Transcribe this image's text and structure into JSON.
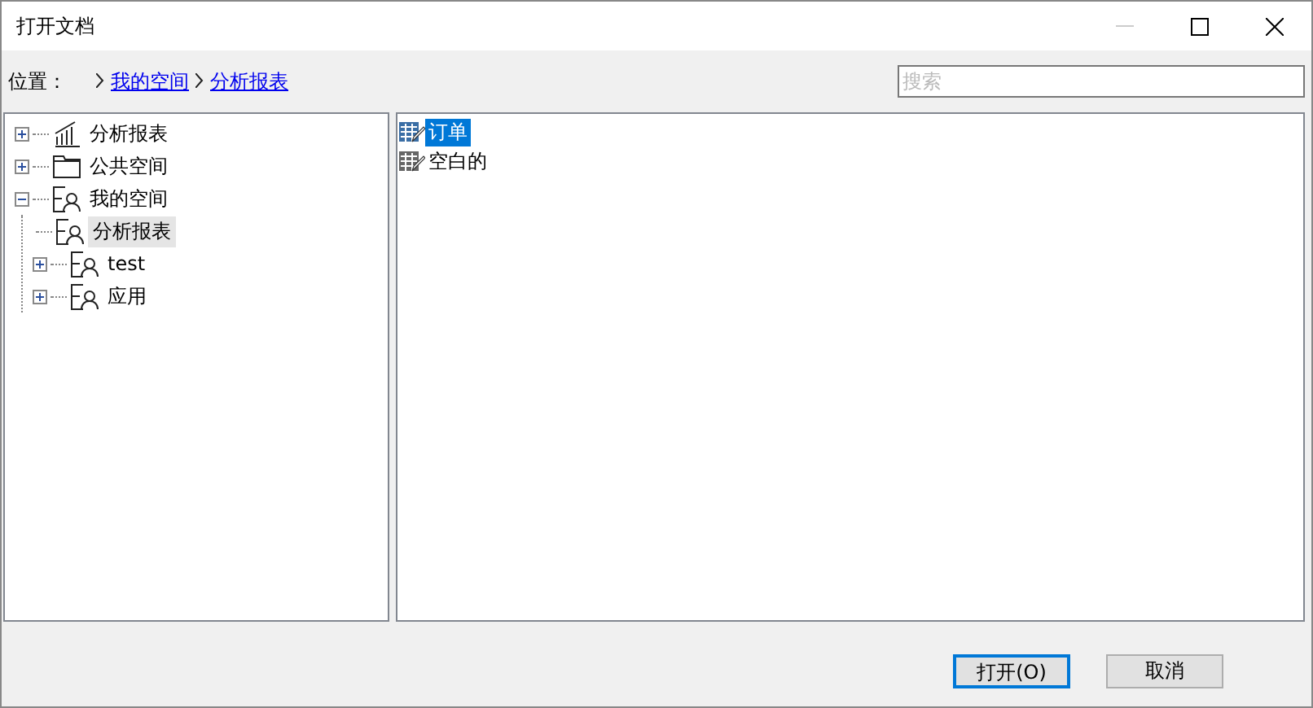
{
  "window": {
    "title": "打开文档",
    "minimize_disabled": true
  },
  "location": {
    "label": "位置：",
    "path": [
      {
        "label": "我的空间"
      },
      {
        "label": "分析报表"
      }
    ]
  },
  "search": {
    "placeholder": "搜索"
  },
  "tree": [
    {
      "label": "分析报表",
      "kind": "chart",
      "expanded": false,
      "selected": false
    },
    {
      "label": "公共空间",
      "kind": "folder",
      "expanded": false,
      "selected": false
    },
    {
      "label": "我的空间",
      "kind": "space",
      "expanded": true,
      "selected": false,
      "children": [
        {
          "label": "分析报表",
          "kind": "space",
          "selected": true
        },
        {
          "label": "test",
          "kind": "space",
          "expanded": false,
          "selected": false
        },
        {
          "label": "应用",
          "kind": "space",
          "expanded": false,
          "selected": false
        }
      ]
    }
  ],
  "files": [
    {
      "label": "订单",
      "selected": true
    },
    {
      "label": "空白的",
      "selected": false
    }
  ],
  "buttons": [
    {
      "label": "打开(O)",
      "default": true
    },
    {
      "label": "取消",
      "default": false
    }
  ]
}
